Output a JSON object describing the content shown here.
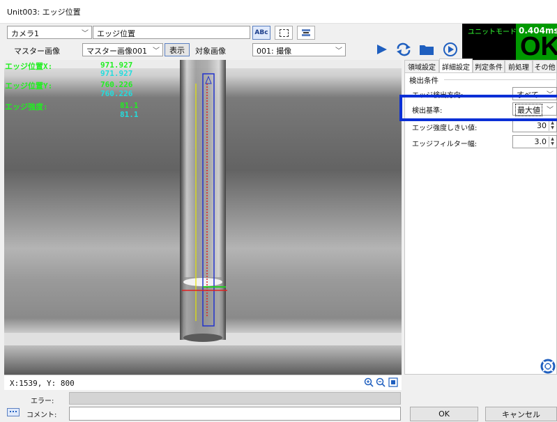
{
  "window": {
    "title": "Unit003: エッジ位置"
  },
  "toolbar": {
    "camera_select": "カメラ1",
    "tool_name": "エッジ位置",
    "master_image_label": "マスター画像",
    "master_image_select": "マスター画像001",
    "show_button": "表示",
    "target_image_label": "対象画像",
    "target_image_select": "001: 撮像"
  },
  "result": {
    "mode": "ユニットモード",
    "time": "0.404ms",
    "judgement": "OK"
  },
  "overlay": {
    "x_label": "エッジ位置X:",
    "x_value1": "971.927",
    "x_value2": "971.927",
    "y_label": "エッジ位置Y:",
    "y_value1": "760.226",
    "y_value2": "760.226",
    "strength_label": "エッジ強度:",
    "strength_value1": "81.1",
    "strength_value2": "81.1"
  },
  "status": {
    "coords": "X:1539, Y: 800",
    "error_label": "エラー:",
    "comment_label": "コメント:"
  },
  "tabs": [
    "領域設定",
    "詳細設定",
    "判定条件",
    "前処理",
    "その他"
  ],
  "settings": {
    "group_title": "検出条件",
    "direction_label": "エッジ検出方向:",
    "direction_value": "すべて",
    "criterion_label": "検出基準:",
    "criterion_value": "最大値",
    "threshold_label": "エッジ強度しきい値:",
    "threshold_value": "30",
    "filter_label": "エッジフィルター幅:",
    "filter_value": "3.0"
  },
  "buttons": {
    "ok": "OK",
    "cancel": "キャンセル"
  },
  "colors": {
    "overlay_green": "#22ee22",
    "overlay_cyan": "#22dddd",
    "highlight_blue": "#0a2fd6",
    "result_green": "#009900"
  }
}
